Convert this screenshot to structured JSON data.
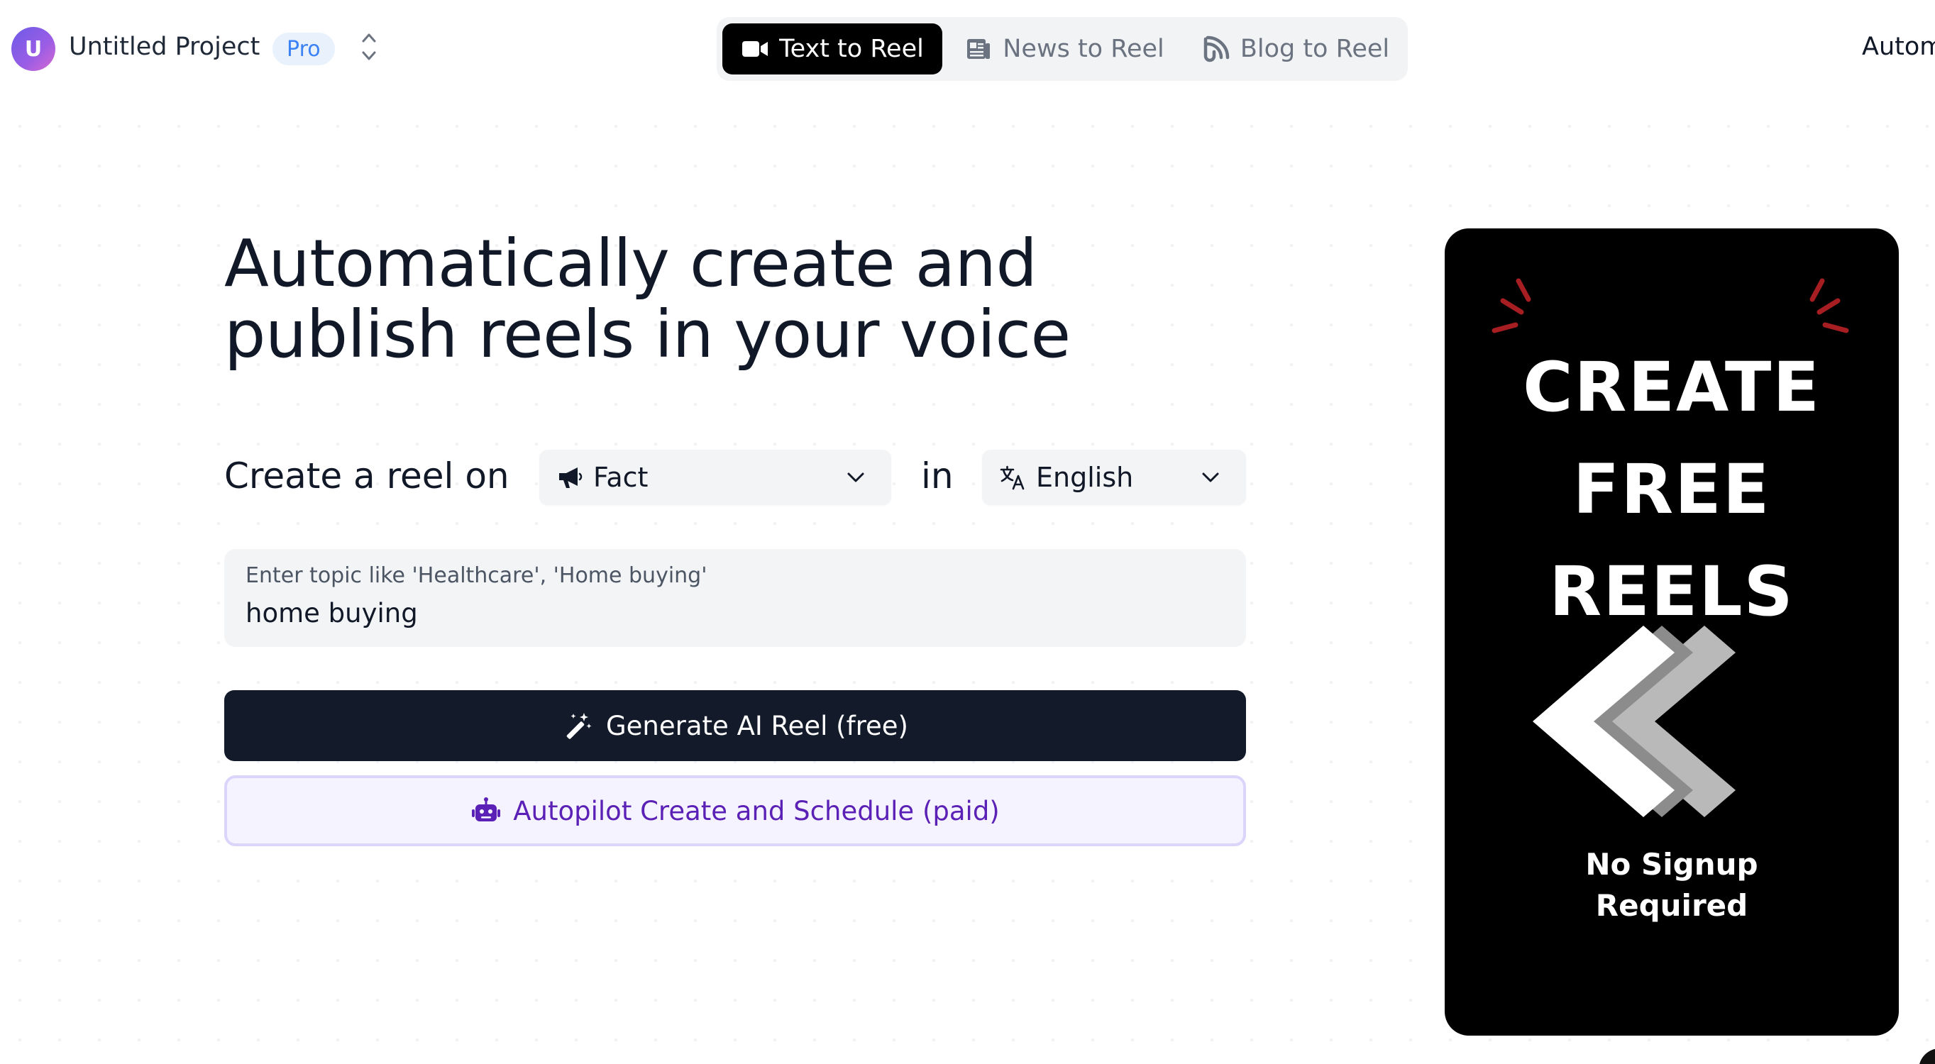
{
  "header": {
    "avatar_initial": "U",
    "project_name": "Untitled Project",
    "plan_badge": "Pro",
    "tabs": [
      {
        "label": "Text to Reel",
        "icon": "video-camera-icon",
        "active": true
      },
      {
        "label": "News to Reel",
        "icon": "newspaper-icon",
        "active": false
      },
      {
        "label": "Blog to Reel",
        "icon": "rss-feed-icon",
        "active": false
      }
    ],
    "right_link": "Autom"
  },
  "hero": {
    "title_line1": "Automatically create and",
    "title_line2": "publish reels in your voice"
  },
  "form": {
    "row_label": "Create a reel on",
    "type_select": {
      "value": "Fact",
      "icon": "megaphone-icon"
    },
    "in_label": "in",
    "language_select": {
      "value": "English",
      "icon": "translate-icon"
    },
    "topic": {
      "placeholder_label": "Enter topic like 'Healthcare', 'Home buying'",
      "value": "home buying"
    },
    "generate_button": "Generate AI Reel (free)",
    "autopilot_button": "Autopilot Create and Schedule (paid)"
  },
  "preview": {
    "line1": "CREATE",
    "line2": "FREE",
    "line3": "REELS",
    "sub1": "No Signup",
    "sub2": "Required"
  },
  "colors": {
    "active_tab_bg": "#000000",
    "generate_bg": "#131a29",
    "autopilot_bg": "#f5f3ff",
    "autopilot_text": "#5b21b6",
    "pro_badge_text": "#3b82f6",
    "spark_red": "#a61e22"
  }
}
